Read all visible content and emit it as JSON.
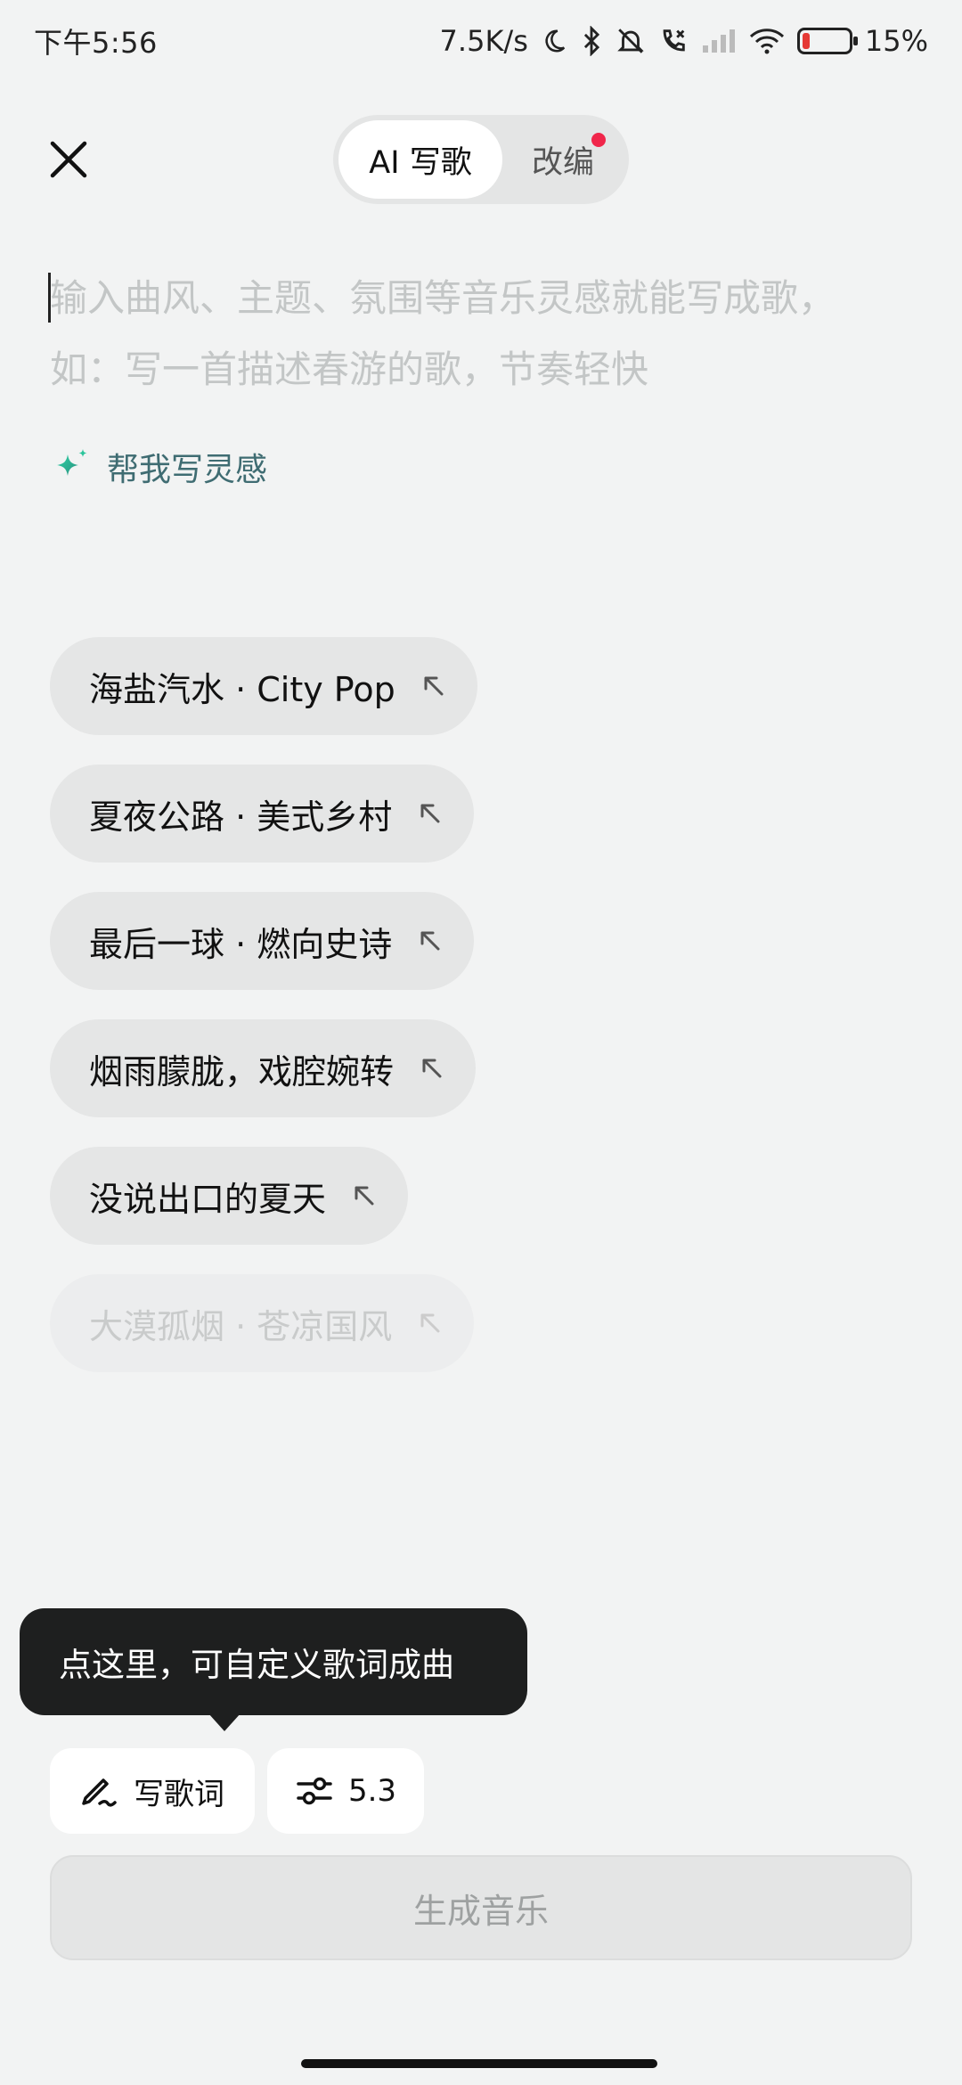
{
  "status": {
    "time": "下午5:56",
    "speed": "7.5K/s",
    "battery": "15%",
    "battery_level": 0.15
  },
  "header": {
    "tabs": [
      {
        "label": "AI 写歌",
        "active": true
      },
      {
        "label": "改编",
        "active": false,
        "badge": true
      }
    ]
  },
  "prompt": {
    "placeholder_line1": "输入曲风、主题、氛围等音乐灵感就能写成歌，",
    "placeholder_line2": "如：写一首描述春游的歌，节奏轻快"
  },
  "inspire": {
    "label": "帮我写灵感"
  },
  "suggestions": [
    {
      "label": "海盐汽水 · City Pop"
    },
    {
      "label": "夏夜公路 · 美式乡村"
    },
    {
      "label": "最后一球 · 燃向史诗"
    },
    {
      "label": "烟雨朦胧，戏腔婉转"
    },
    {
      "label": "没说出口的夏天"
    },
    {
      "label": "大漠孤烟 · 苍凉国风"
    }
  ],
  "tooltip": {
    "text": "点这里，可自定义歌词成曲"
  },
  "tools": {
    "lyrics_label": "写歌词",
    "version_label": "5.3"
  },
  "generate": {
    "label": "生成音乐"
  },
  "colors": {
    "accent_teal": "#3f6c72",
    "badge_red": "#f0264a",
    "battery_red": "#e53935"
  }
}
